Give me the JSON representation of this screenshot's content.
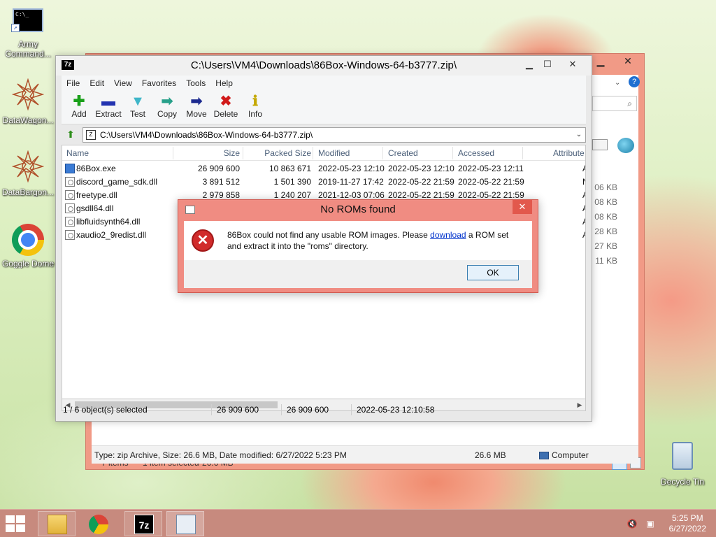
{
  "desktop": {
    "icons": [
      {
        "label_line1": "Army",
        "label_line2": "Command..."
      },
      {
        "label_line1": "DataWagon...",
        "label_line2": ""
      },
      {
        "label_line1": "DataBargon...",
        "label_line2": ""
      },
      {
        "label_line1": "Goggle Dome",
        "label_line2": ""
      }
    ],
    "recycle_bin_label": "Decycle Tin"
  },
  "explorer_bg": {
    "sizes": [
      "06 KB",
      "08 KB",
      "08 KB",
      "28 KB",
      "27 KB",
      "11 KB"
    ],
    "items_count": "7 items",
    "selected_info": "1 item selected",
    "selected_size": "26.6 MB",
    "status_text": "Type: zip Archive, Size: 26.6 MB, Date modified: 6/27/2022 5:23 PM",
    "status_size": "26.6 MB",
    "status_location": "Computer"
  },
  "zip": {
    "title": "C:\\Users\\VM4\\Downloads\\86Box-Windows-64-b3777.zip\\",
    "logo": "7z",
    "menu": [
      "File",
      "Edit",
      "View",
      "Favorites",
      "Tools",
      "Help"
    ],
    "toolbar": [
      {
        "label": "Add",
        "icon": "add-icon",
        "glyph": "✚",
        "color": "#19a019"
      },
      {
        "label": "Extract",
        "icon": "extract-icon",
        "glyph": "▬",
        "color": "#2233b0"
      },
      {
        "label": "Test",
        "icon": "test-icon",
        "glyph": "▼",
        "color": "#3fb6c9"
      },
      {
        "label": "Copy",
        "icon": "copy-icon",
        "glyph": "➡",
        "color": "#27a08a"
      },
      {
        "label": "Move",
        "icon": "move-icon",
        "glyph": "➡",
        "color": "#1c2a90"
      },
      {
        "label": "Delete",
        "icon": "delete-icon",
        "glyph": "✖",
        "color": "#d11a1a"
      },
      {
        "label": "Info",
        "icon": "info-icon",
        "glyph": "ℹ",
        "color": "#c4a800"
      }
    ],
    "address": "C:\\Users\\VM4\\Downloads\\86Box-Windows-64-b3777.zip\\",
    "columns": {
      "name": "Name",
      "size": "Size",
      "packed": "Packed Size",
      "modified": "Modified",
      "created": "Created",
      "accessed": "Accessed",
      "attributes": "Attribute"
    },
    "files": [
      {
        "name": "86Box.exe",
        "type": "exe",
        "size": "26 909 600",
        "packed": "10 863 671",
        "modified": "2022-05-23 12:10",
        "created": "2022-05-23 12:10",
        "accessed": "2022-05-23 12:11",
        "attr": "A"
      },
      {
        "name": "discord_game_sdk.dll",
        "type": "dll",
        "size": "3 891 512",
        "packed": "1 501 390",
        "modified": "2019-11-27 17:42",
        "created": "2022-05-22 21:59",
        "accessed": "2022-05-22 21:59",
        "attr": "N"
      },
      {
        "name": "freetype.dll",
        "type": "dll",
        "size": "2 979 858",
        "packed": "1 240 207",
        "modified": "2021-12-03 07:06",
        "created": "2022-05-22 21:59",
        "accessed": "2022-05-22 21:59",
        "attr": "A"
      },
      {
        "name": "gsdll64.dll",
        "type": "dll",
        "size": "",
        "packed": "",
        "modified": "",
        "created": "",
        "accessed": "",
        "attr": "A"
      },
      {
        "name": "libfluidsynth64.dll",
        "type": "dll",
        "size": "",
        "packed": "",
        "modified": "",
        "created": "",
        "accessed": "",
        "attr": "A"
      },
      {
        "name": "xaudio2_9redist.dll",
        "type": "dll",
        "size": "",
        "packed": "",
        "modified": "",
        "created": "",
        "accessed": "",
        "attr": "A"
      }
    ],
    "status": {
      "selection": "1 / 6 object(s) selected",
      "size": "26 909 600",
      "packed": "26 909 600",
      "modified": "2022-05-23 12:10:58"
    }
  },
  "dialog": {
    "title": "No ROMs found",
    "message_before": "86Box could not find any usable ROM images. Please ",
    "link": "download",
    "message_after": " a ROM set and extract it into the \"roms\" directory.",
    "ok": "OK"
  },
  "taskbar": {
    "time": "5:25 PM",
    "date": "6/27/2022",
    "zip_label": "7z"
  }
}
